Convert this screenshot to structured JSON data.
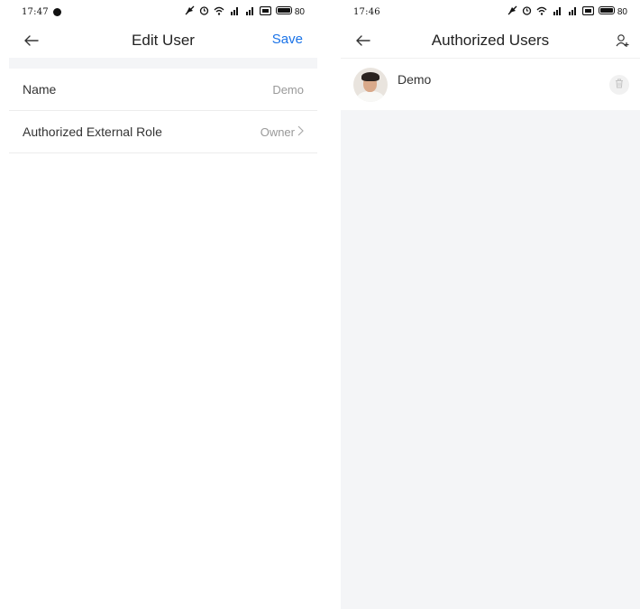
{
  "left": {
    "status": {
      "time": "17:47",
      "battery": "80"
    },
    "nav": {
      "title": "Edit User",
      "save_label": "Save"
    },
    "rows": [
      {
        "label": "Name",
        "value": "Demo"
      },
      {
        "label": "Authorized External Role",
        "value": "Owner"
      }
    ]
  },
  "right": {
    "status": {
      "time": "17:46",
      "battery": "80"
    },
    "nav": {
      "title": "Authorized Users"
    },
    "users": [
      {
        "name": "Demo"
      }
    ]
  },
  "colors": {
    "accent": "#1a73e8",
    "background": "#f4f5f7"
  },
  "icons": [
    "back-arrow-icon",
    "add-user-icon",
    "trash-icon",
    "chevron-right-icon",
    "avatar-photo"
  ]
}
